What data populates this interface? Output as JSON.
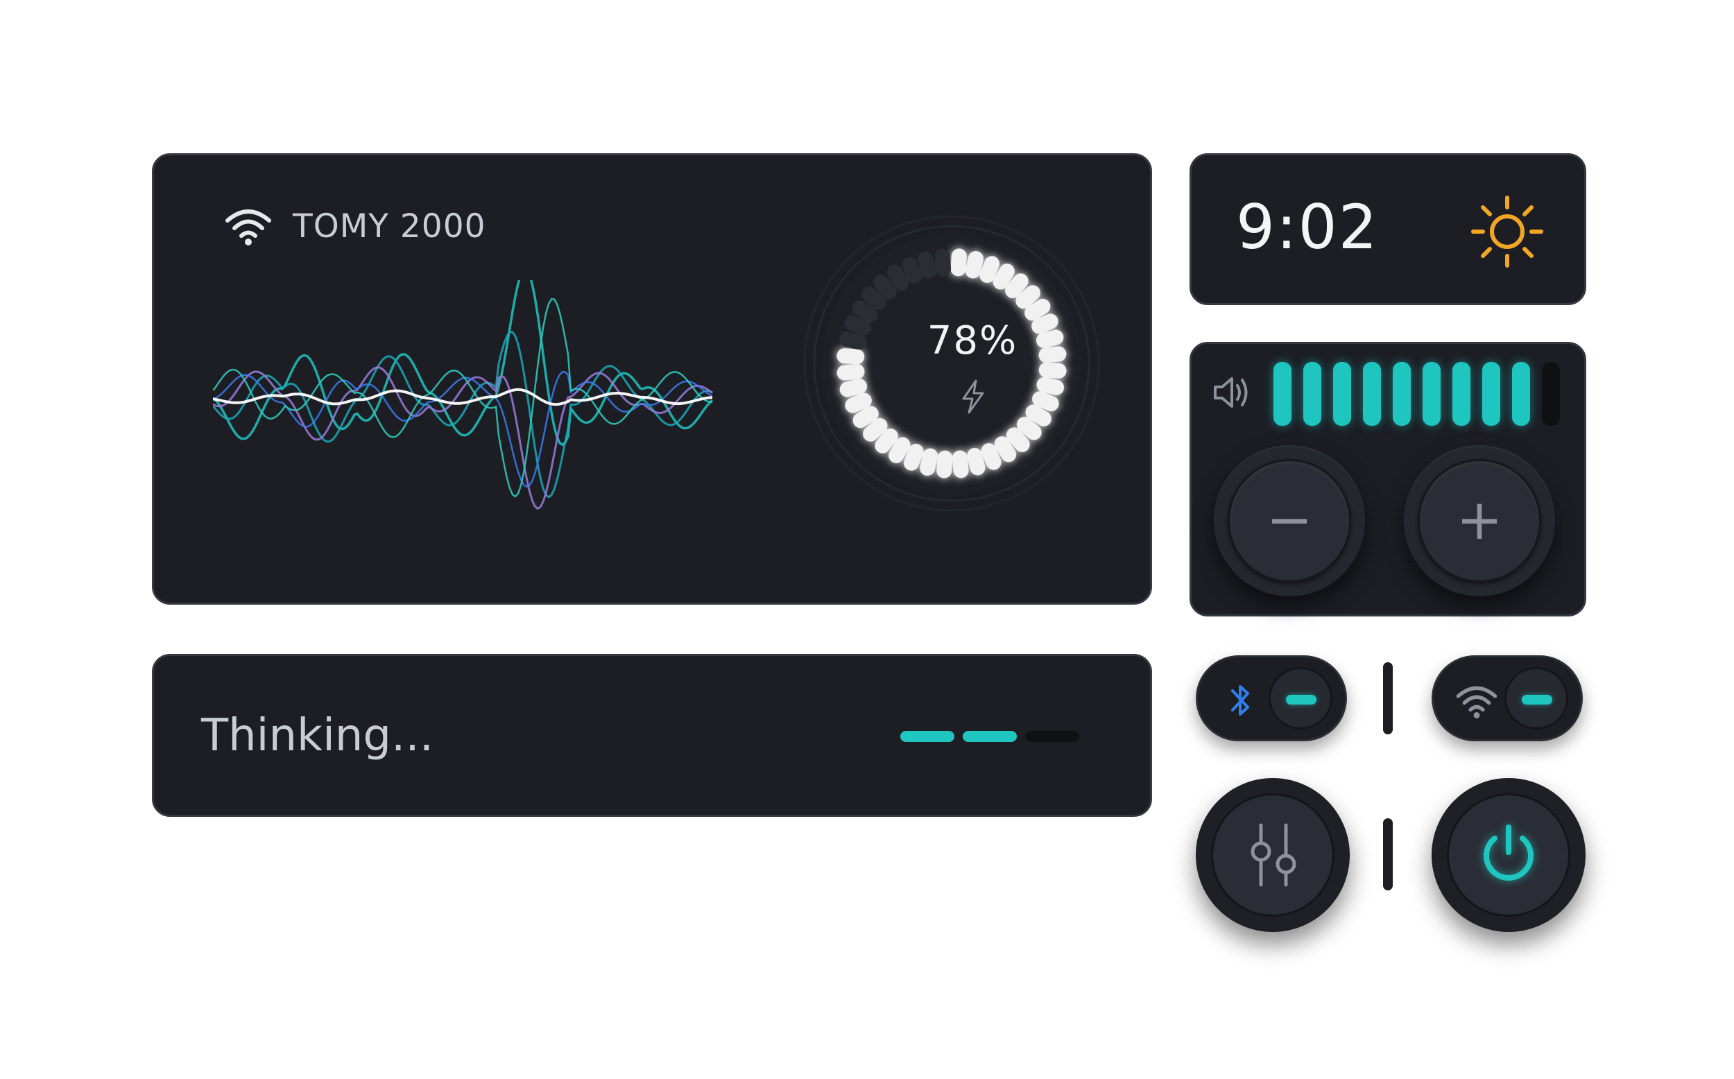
{
  "device": {
    "name": "TOMY 2000",
    "wifi_icon": "wifi-icon"
  },
  "battery": {
    "percent_text": "78%",
    "level": 0.78,
    "icon": "bolt-icon"
  },
  "status": {
    "text": "Thinking...",
    "dashes": [
      {
        "state": "on"
      },
      {
        "state": "on"
      },
      {
        "state": "off"
      }
    ]
  },
  "clock": {
    "time": "9:02",
    "icon": "sun-icon"
  },
  "volume": {
    "level": 9,
    "max": 10,
    "icon": "speaker-icon",
    "decrease_label": "−",
    "increase_label": "+"
  },
  "toggles": [
    {
      "icon": "bluetooth-icon",
      "on": true
    },
    {
      "icon": "wifi-icon",
      "on": true
    }
  ],
  "buttons": [
    {
      "icon": "sliders-icon"
    },
    {
      "icon": "power-icon"
    }
  ],
  "colors": {
    "accent": "#1fc5bf",
    "panel": "#1c1e24",
    "sun": "#f2a623",
    "bluetooth": "#2f7ff0",
    "text": "#c9ccd3"
  }
}
